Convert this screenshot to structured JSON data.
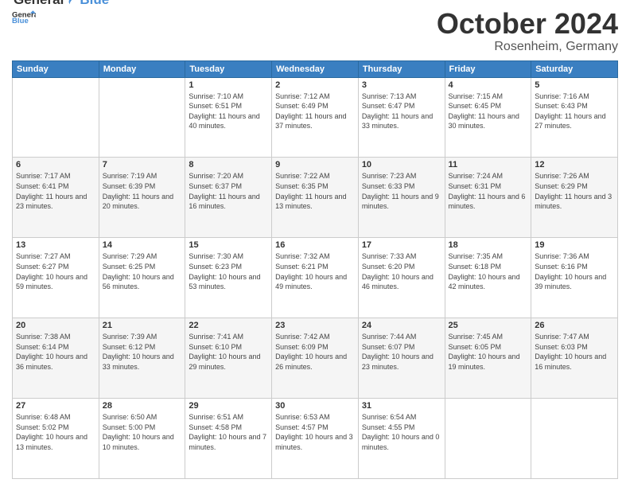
{
  "header": {
    "logo_line1": "General",
    "logo_line2": "Blue",
    "month_title": "October 2024",
    "subtitle": "Rosenheim, Germany"
  },
  "weekdays": [
    "Sunday",
    "Monday",
    "Tuesday",
    "Wednesday",
    "Thursday",
    "Friday",
    "Saturday"
  ],
  "weeks": [
    [
      {
        "day": "",
        "info": ""
      },
      {
        "day": "",
        "info": ""
      },
      {
        "day": "1",
        "info": "Sunrise: 7:10 AM\nSunset: 6:51 PM\nDaylight: 11 hours and 40 minutes."
      },
      {
        "day": "2",
        "info": "Sunrise: 7:12 AM\nSunset: 6:49 PM\nDaylight: 11 hours and 37 minutes."
      },
      {
        "day": "3",
        "info": "Sunrise: 7:13 AM\nSunset: 6:47 PM\nDaylight: 11 hours and 33 minutes."
      },
      {
        "day": "4",
        "info": "Sunrise: 7:15 AM\nSunset: 6:45 PM\nDaylight: 11 hours and 30 minutes."
      },
      {
        "day": "5",
        "info": "Sunrise: 7:16 AM\nSunset: 6:43 PM\nDaylight: 11 hours and 27 minutes."
      }
    ],
    [
      {
        "day": "6",
        "info": "Sunrise: 7:17 AM\nSunset: 6:41 PM\nDaylight: 11 hours and 23 minutes."
      },
      {
        "day": "7",
        "info": "Sunrise: 7:19 AM\nSunset: 6:39 PM\nDaylight: 11 hours and 20 minutes."
      },
      {
        "day": "8",
        "info": "Sunrise: 7:20 AM\nSunset: 6:37 PM\nDaylight: 11 hours and 16 minutes."
      },
      {
        "day": "9",
        "info": "Sunrise: 7:22 AM\nSunset: 6:35 PM\nDaylight: 11 hours and 13 minutes."
      },
      {
        "day": "10",
        "info": "Sunrise: 7:23 AM\nSunset: 6:33 PM\nDaylight: 11 hours and 9 minutes."
      },
      {
        "day": "11",
        "info": "Sunrise: 7:24 AM\nSunset: 6:31 PM\nDaylight: 11 hours and 6 minutes."
      },
      {
        "day": "12",
        "info": "Sunrise: 7:26 AM\nSunset: 6:29 PM\nDaylight: 11 hours and 3 minutes."
      }
    ],
    [
      {
        "day": "13",
        "info": "Sunrise: 7:27 AM\nSunset: 6:27 PM\nDaylight: 10 hours and 59 minutes."
      },
      {
        "day": "14",
        "info": "Sunrise: 7:29 AM\nSunset: 6:25 PM\nDaylight: 10 hours and 56 minutes."
      },
      {
        "day": "15",
        "info": "Sunrise: 7:30 AM\nSunset: 6:23 PM\nDaylight: 10 hours and 53 minutes."
      },
      {
        "day": "16",
        "info": "Sunrise: 7:32 AM\nSunset: 6:21 PM\nDaylight: 10 hours and 49 minutes."
      },
      {
        "day": "17",
        "info": "Sunrise: 7:33 AM\nSunset: 6:20 PM\nDaylight: 10 hours and 46 minutes."
      },
      {
        "day": "18",
        "info": "Sunrise: 7:35 AM\nSunset: 6:18 PM\nDaylight: 10 hours and 42 minutes."
      },
      {
        "day": "19",
        "info": "Sunrise: 7:36 AM\nSunset: 6:16 PM\nDaylight: 10 hours and 39 minutes."
      }
    ],
    [
      {
        "day": "20",
        "info": "Sunrise: 7:38 AM\nSunset: 6:14 PM\nDaylight: 10 hours and 36 minutes."
      },
      {
        "day": "21",
        "info": "Sunrise: 7:39 AM\nSunset: 6:12 PM\nDaylight: 10 hours and 33 minutes."
      },
      {
        "day": "22",
        "info": "Sunrise: 7:41 AM\nSunset: 6:10 PM\nDaylight: 10 hours and 29 minutes."
      },
      {
        "day": "23",
        "info": "Sunrise: 7:42 AM\nSunset: 6:09 PM\nDaylight: 10 hours and 26 minutes."
      },
      {
        "day": "24",
        "info": "Sunrise: 7:44 AM\nSunset: 6:07 PM\nDaylight: 10 hours and 23 minutes."
      },
      {
        "day": "25",
        "info": "Sunrise: 7:45 AM\nSunset: 6:05 PM\nDaylight: 10 hours and 19 minutes."
      },
      {
        "day": "26",
        "info": "Sunrise: 7:47 AM\nSunset: 6:03 PM\nDaylight: 10 hours and 16 minutes."
      }
    ],
    [
      {
        "day": "27",
        "info": "Sunrise: 6:48 AM\nSunset: 5:02 PM\nDaylight: 10 hours and 13 minutes."
      },
      {
        "day": "28",
        "info": "Sunrise: 6:50 AM\nSunset: 5:00 PM\nDaylight: 10 hours and 10 minutes."
      },
      {
        "day": "29",
        "info": "Sunrise: 6:51 AM\nSunset: 4:58 PM\nDaylight: 10 hours and 7 minutes."
      },
      {
        "day": "30",
        "info": "Sunrise: 6:53 AM\nSunset: 4:57 PM\nDaylight: 10 hours and 3 minutes."
      },
      {
        "day": "31",
        "info": "Sunrise: 6:54 AM\nSunset: 4:55 PM\nDaylight: 10 hours and 0 minutes."
      },
      {
        "day": "",
        "info": ""
      },
      {
        "day": "",
        "info": ""
      }
    ]
  ]
}
